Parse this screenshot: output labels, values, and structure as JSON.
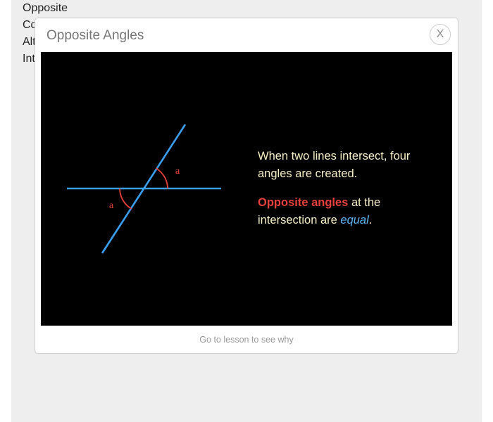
{
  "background_list": {
    "items": [
      "Opposite",
      "Co",
      "Alt",
      "Int"
    ]
  },
  "modal": {
    "title": "Opposite Angles",
    "close_label": "X",
    "footer_link": "Go to lesson to see why"
  },
  "diagram": {
    "angle_label_top": "a",
    "angle_label_bottom": "a",
    "line_color": "#3a9ff0",
    "angle_color": "#e8413b"
  },
  "caption": {
    "line1": "When two lines intersect, four angles are created.",
    "emphasis_red": "Opposite angles",
    "middle": " at the intersection are ",
    "emphasis_blue": "equal",
    "end": "."
  }
}
